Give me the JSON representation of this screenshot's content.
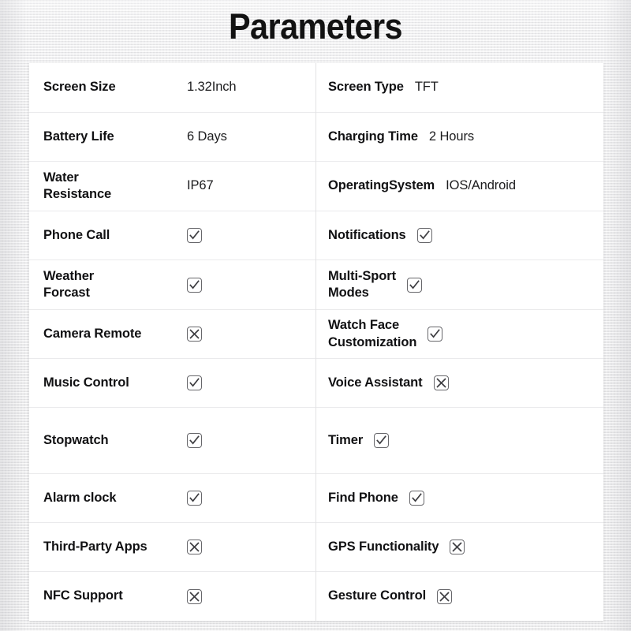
{
  "title": "Parameters",
  "colors": {
    "page_background": "#ededee",
    "table_background": "#ffffff",
    "row_divider": "#eaeaec",
    "label_text": "#111113",
    "value_text": "#1c1c1e",
    "checkbox_border": "#67676b",
    "checkbox_mark": "#3d3d41"
  },
  "table": {
    "left_column": [
      {
        "label": "Screen Size",
        "type": "text",
        "value": "1.32Inch",
        "height": "h-63"
      },
      {
        "label": "Battery Life",
        "type": "text",
        "value": "6 Days",
        "height": "h-62"
      },
      {
        "label": "Water\nResistance",
        "type": "text",
        "value": "IP67",
        "height": "h-63"
      },
      {
        "label": "Phone Call",
        "type": "check",
        "value": "checked",
        "height": "h-62"
      },
      {
        "label": "Weather\nForcast",
        "type": "check",
        "value": "checked",
        "height": "h-63"
      },
      {
        "label": "Camera Remote",
        "type": "check",
        "value": "unchecked",
        "height": "h-62"
      },
      {
        "label": "Music Control",
        "type": "check",
        "value": "checked",
        "height": "h-62"
      },
      {
        "label": "Stopwatch",
        "type": "check",
        "value": "checked",
        "height": "h-84"
      },
      {
        "label": "Alarm clock",
        "type": "check",
        "value": "checked",
        "height": "h-62"
      },
      {
        "label": "Third-Party Apps",
        "type": "check",
        "value": "unchecked",
        "height": "h-62"
      },
      {
        "label": "NFC Support",
        "type": "check",
        "value": "unchecked",
        "height": "h-62"
      }
    ],
    "right_column": [
      {
        "label": "Screen Type",
        "type": "text",
        "value": "TFT",
        "height": "h-63"
      },
      {
        "label": "Charging Time",
        "type": "text",
        "value": "2 Hours",
        "height": "h-62"
      },
      {
        "label": "OperatingSystem",
        "type": "text",
        "value": "IOS/Android",
        "height": "h-63"
      },
      {
        "label": "Notifications",
        "type": "check",
        "value": "checked",
        "height": "h-62"
      },
      {
        "label": "Multi-Sport\nModes",
        "type": "check",
        "value": "checked",
        "height": "h-63"
      },
      {
        "label": "Watch Face\nCustomization",
        "type": "check",
        "value": "checked",
        "height": "h-62"
      },
      {
        "label": "Voice Assistant",
        "type": "check",
        "value": "unchecked",
        "height": "h-62"
      },
      {
        "label": "Timer",
        "type": "check",
        "value": "checked",
        "height": "h-84"
      },
      {
        "label": "Find Phone",
        "type": "check",
        "value": "checked",
        "height": "h-62"
      },
      {
        "label": "GPS Functionality",
        "type": "check",
        "value": "unchecked",
        "height": "h-62"
      },
      {
        "label": "Gesture Control",
        "type": "check",
        "value": "unchecked",
        "height": "h-62"
      }
    ]
  }
}
